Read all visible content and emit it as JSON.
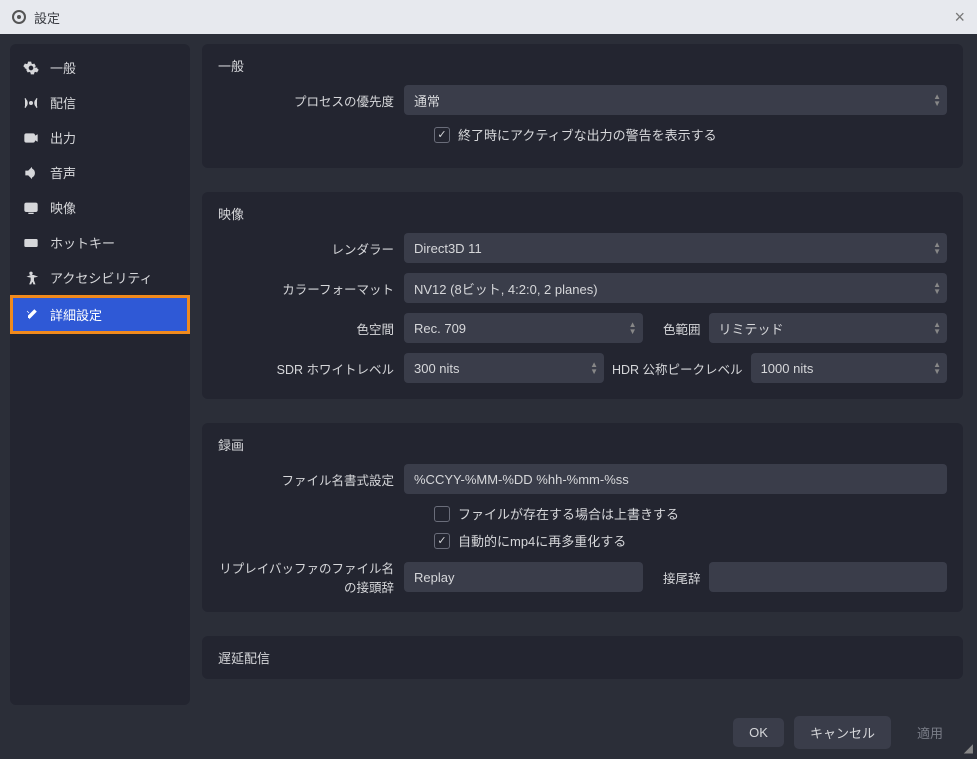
{
  "title": "設定",
  "sidebar": {
    "items": [
      {
        "label": "一般"
      },
      {
        "label": "配信"
      },
      {
        "label": "出力"
      },
      {
        "label": "音声"
      },
      {
        "label": "映像"
      },
      {
        "label": "ホットキー"
      },
      {
        "label": "アクセシビリティ"
      },
      {
        "label": "詳細設定"
      }
    ]
  },
  "general": {
    "title": "一般",
    "priority_label": "プロセスの優先度",
    "priority_value": "通常",
    "warn_active_label": "終了時にアクティブな出力の警告を表示する"
  },
  "video": {
    "title": "映像",
    "renderer_label": "レンダラー",
    "renderer_value": "Direct3D 11",
    "color_format_label": "カラーフォーマット",
    "color_format_value": "NV12 (8ビット, 4:2:0, 2 planes)",
    "color_space_label": "色空間",
    "color_space_value": "Rec. 709",
    "color_range_label": "色範囲",
    "color_range_value": "リミテッド",
    "sdr_white_label": "SDR ホワイトレベル",
    "sdr_white_value": "300 nits",
    "hdr_peak_label": "HDR 公称ピークレベル",
    "hdr_peak_value": "1000 nits"
  },
  "recording": {
    "title": "録画",
    "file_format_label": "ファイル名書式設定",
    "file_format_value": "%CCYY-%MM-%DD %hh-%mm-%ss",
    "overwrite_label": "ファイルが存在する場合は上書きする",
    "remux_label": "自動的にmp4に再多重化する",
    "replay_prefix_label": "リプレイバッファのファイル名の接頭辞",
    "replay_prefix_value": "Replay",
    "replay_suffix_label": "接尾辞",
    "replay_suffix_value": ""
  },
  "delay": {
    "title": "遅延配信"
  },
  "footer": {
    "ok": "OK",
    "cancel": "キャンセル",
    "apply": "適用"
  }
}
